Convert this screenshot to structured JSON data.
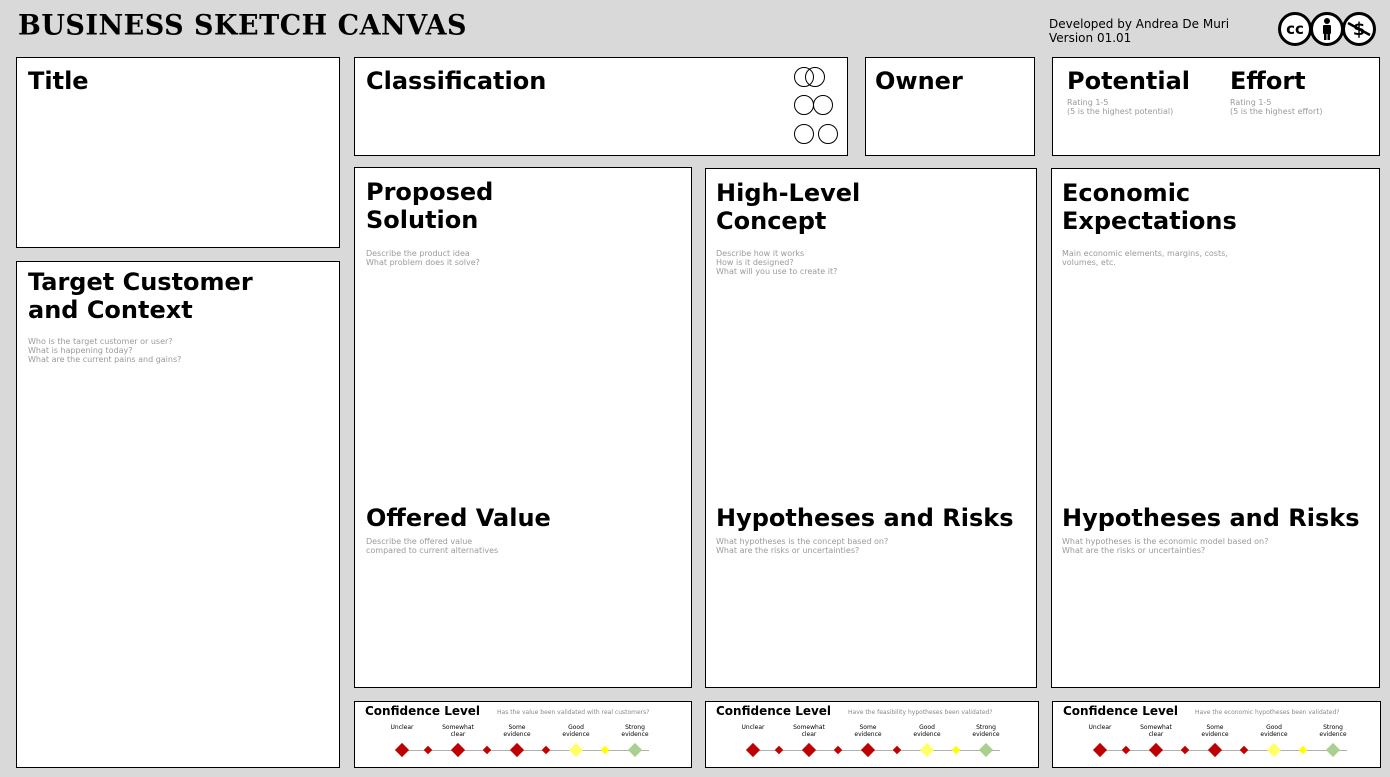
{
  "header": {
    "title": "BUSINESS SKETCH CANVAS",
    "developer": "Developed by Andrea De Muri",
    "version": "Version 01.01",
    "license_icons": [
      "cc-icon",
      "attribution-person-icon",
      "noncommercial-dollar-icon"
    ],
    "license_cc": "cc"
  },
  "title_box": {
    "heading": "Title"
  },
  "target": {
    "heading_l1": "Target Customer",
    "heading_l2": "and Context",
    "hint": "Who is the target customer or user?\nWhat is happening today?\nWhat are the current pains and gains?"
  },
  "classification": {
    "heading": "Classification"
  },
  "owner": {
    "heading": "Owner"
  },
  "potential": {
    "heading": "Potential",
    "hint": "Rating 1-5\n(5 is the highest potential)"
  },
  "effort": {
    "heading": "Effort",
    "hint": "Rating 1-5\n(5 is the highest effort)"
  },
  "proposed": {
    "heading_l1": "Proposed",
    "heading_l2": "Solution",
    "hint": "Describe the product idea\nWhat problem does it solve?"
  },
  "offered": {
    "heading": "Offered Value",
    "hint": "Describe the offered value\ncompared to current alternatives"
  },
  "concept": {
    "heading_l1": "High-Level",
    "heading_l2": "Concept",
    "hint": "Describe how it works\nHow is it designed?\nWhat will you use to create it?"
  },
  "concept_risks": {
    "heading": "Hypotheses and Risks",
    "hint": "What hypotheses is the concept based on?\nWhat are the risks or uncertainties?"
  },
  "economic": {
    "heading_l1": "Economic",
    "heading_l2": "Expectations",
    "hint": "Main economic elements, margins, costs,\nvolumes, etc."
  },
  "economic_risks": {
    "heading": "Hypotheses and Risks",
    "hint": "What hypotheses is the economic model based on?\nWhat are the risks or uncertainties?"
  },
  "confidence": [
    {
      "title": "Confidence Level",
      "question": "Has the value been validated with real customers?"
    },
    {
      "title": "Confidence Level",
      "question": "Have the feasibility hypotheses been validated?"
    },
    {
      "title": "Confidence Level",
      "question": "Have the economic hypotheses been validated?"
    }
  ],
  "confidence_scale": [
    {
      "label": "Unclear",
      "color": "#c00000"
    },
    {
      "label": "Somewhat\nclear",
      "color": "#c00000"
    },
    {
      "label": "Some\nevidence",
      "color": "#c00000"
    },
    {
      "label": "Good\nevidence",
      "color": "#ffff66"
    },
    {
      "label": "Strong\nevidence",
      "color": "#a9d08e"
    }
  ],
  "confidence_small_colors": [
    "#c00000",
    "#c00000",
    "#c00000",
    "#ffff00"
  ]
}
